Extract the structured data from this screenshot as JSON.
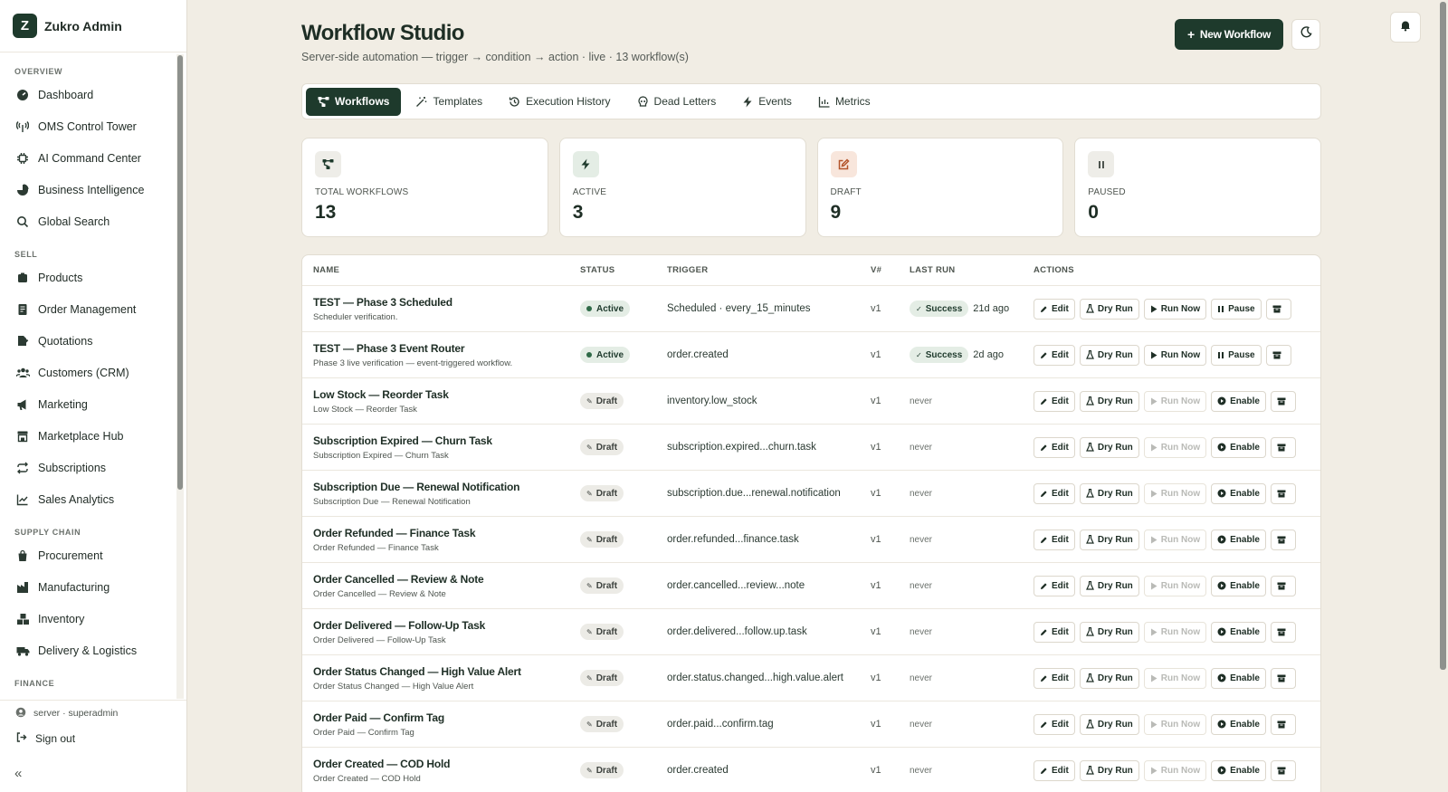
{
  "brand": {
    "logo_letter": "Z",
    "name": "Zukro Admin"
  },
  "sidebar": {
    "sections": [
      {
        "title": "OVERVIEW",
        "items": [
          {
            "label": "Dashboard",
            "icon": "gauge-icon"
          },
          {
            "label": "OMS Control Tower",
            "icon": "tower-icon"
          },
          {
            "label": "AI Command Center",
            "icon": "cpu-icon"
          },
          {
            "label": "Business Intelligence",
            "icon": "pie-chart-icon"
          },
          {
            "label": "Global Search",
            "icon": "search-icon"
          }
        ]
      },
      {
        "title": "SELL",
        "items": [
          {
            "label": "Products",
            "icon": "box-icon"
          },
          {
            "label": "Order Management",
            "icon": "receipt-icon"
          },
          {
            "label": "Quotations",
            "icon": "file-edit-icon"
          },
          {
            "label": "Customers (CRM)",
            "icon": "users-icon"
          },
          {
            "label": "Marketing",
            "icon": "megaphone-icon"
          },
          {
            "label": "Marketplace Hub",
            "icon": "store-icon"
          },
          {
            "label": "Subscriptions",
            "icon": "repeat-icon"
          },
          {
            "label": "Sales Analytics",
            "icon": "line-chart-icon"
          }
        ]
      },
      {
        "title": "SUPPLY CHAIN",
        "items": [
          {
            "label": "Procurement",
            "icon": "shopping-bag-icon"
          },
          {
            "label": "Manufacturing",
            "icon": "factory-icon"
          },
          {
            "label": "Inventory",
            "icon": "boxes-icon"
          },
          {
            "label": "Delivery & Logistics",
            "icon": "truck-icon"
          }
        ]
      },
      {
        "title": "FINANCE",
        "items": []
      }
    ],
    "footer": {
      "user": "server · superadmin",
      "signout": "Sign out"
    }
  },
  "header": {
    "title": "Workflow Studio",
    "subtitle": "Server-side automation — trigger → condition → action · live · 13 workflow(s)",
    "new_button": "New Workflow"
  },
  "tabs": [
    {
      "label": "Workflows",
      "icon": "workflow-icon",
      "active": true
    },
    {
      "label": "Templates",
      "icon": "wand-icon",
      "active": false
    },
    {
      "label": "Execution History",
      "icon": "history-icon",
      "active": false
    },
    {
      "label": "Dead Letters",
      "icon": "skull-icon",
      "active": false
    },
    {
      "label": "Events",
      "icon": "bolt-icon",
      "active": false
    },
    {
      "label": "Metrics",
      "icon": "bar-chart-icon",
      "active": false
    }
  ],
  "stats": [
    {
      "label": "TOTAL WORKFLOWS",
      "value": "13",
      "icon": "workflow-icon",
      "bg": "#eeede8",
      "fg": "#1e3a2c"
    },
    {
      "label": "ACTIVE",
      "value": "3",
      "icon": "bolt-icon",
      "bg": "#e4ede5",
      "fg": "#1e3a2c"
    },
    {
      "label": "DRAFT",
      "value": "9",
      "icon": "edit-icon",
      "bg": "#f8e6dc",
      "fg": "#b3542a"
    },
    {
      "label": "PAUSED",
      "value": "0",
      "icon": "pause-icon",
      "bg": "#eeede8",
      "fg": "#4e554f"
    }
  ],
  "table": {
    "headers": {
      "name": "NAME",
      "status": "STATUS",
      "trigger": "TRIGGER",
      "version": "V#",
      "last_run": "LAST RUN",
      "actions": "ACTIONS"
    },
    "action_labels": {
      "edit": "Edit",
      "dry_run": "Dry Run",
      "run_now": "Run Now",
      "pause": "Pause",
      "enable": "Enable"
    },
    "success_label": "Success",
    "rows": [
      {
        "name": "TEST — Phase 3 Scheduled",
        "desc": "Scheduler verification.",
        "status": "Active",
        "trigger": "Scheduled · every_15_minutes",
        "version": "v1",
        "last_run": "21d ago",
        "last_status": "Success"
      },
      {
        "name": "TEST — Phase 3 Event Router",
        "desc": "Phase 3 live verification — event-triggered workflow.",
        "status": "Active",
        "trigger": "order.created",
        "version": "v1",
        "last_run": "2d ago",
        "last_status": "Success"
      },
      {
        "name": "Low Stock — Reorder Task",
        "desc": "Low Stock — Reorder Task",
        "status": "Draft",
        "trigger": "inventory.low_stock",
        "version": "v1",
        "last_run": "never",
        "last_status": ""
      },
      {
        "name": "Subscription Expired — Churn Task",
        "desc": "Subscription Expired — Churn Task",
        "status": "Draft",
        "trigger": "subscription.expired...churn.task",
        "version": "v1",
        "last_run": "never",
        "last_status": ""
      },
      {
        "name": "Subscription Due — Renewal Notification",
        "desc": "Subscription Due — Renewal Notification",
        "status": "Draft",
        "trigger": "subscription.due...renewal.notification",
        "version": "v1",
        "last_run": "never",
        "last_status": ""
      },
      {
        "name": "Order Refunded — Finance Task",
        "desc": "Order Refunded — Finance Task",
        "status": "Draft",
        "trigger": "order.refunded...finance.task",
        "version": "v1",
        "last_run": "never",
        "last_status": ""
      },
      {
        "name": "Order Cancelled — Review & Note",
        "desc": "Order Cancelled — Review & Note",
        "status": "Draft",
        "trigger": "order.cancelled...review...note",
        "version": "v1",
        "last_run": "never",
        "last_status": ""
      },
      {
        "name": "Order Delivered — Follow-Up Task",
        "desc": "Order Delivered — Follow-Up Task",
        "status": "Draft",
        "trigger": "order.delivered...follow.up.task",
        "version": "v1",
        "last_run": "never",
        "last_status": ""
      },
      {
        "name": "Order Status Changed — High Value Alert",
        "desc": "Order Status Changed — High Value Alert",
        "status": "Draft",
        "trigger": "order.status.changed...high.value.alert",
        "version": "v1",
        "last_run": "never",
        "last_status": ""
      },
      {
        "name": "Order Paid — Confirm Tag",
        "desc": "Order Paid — Confirm Tag",
        "status": "Draft",
        "trigger": "order.paid...confirm.tag",
        "version": "v1",
        "last_run": "never",
        "last_status": ""
      },
      {
        "name": "Order Created — COD Hold",
        "desc": "Order Created — COD Hold",
        "status": "Draft",
        "trigger": "order.created",
        "version": "v1",
        "last_run": "never",
        "last_status": ""
      }
    ]
  }
}
